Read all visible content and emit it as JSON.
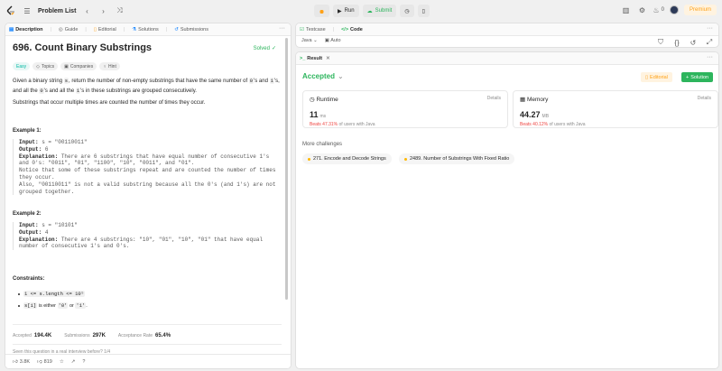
{
  "topbar": {
    "title": "Problem List",
    "run_label": "Run",
    "submit_label": "Submit",
    "notifications_count": "0",
    "premium_label": "Premium"
  },
  "left": {
    "tabs": [
      {
        "label": "Description"
      },
      {
        "label": "Guide"
      },
      {
        "label": "Editorial"
      },
      {
        "label": "Solutions"
      },
      {
        "label": "Submissions"
      }
    ],
    "problem_title": "696. Count Binary Substrings",
    "solved_label": "Solved",
    "tags": {
      "difficulty": "Easy",
      "topics": "Topics",
      "companies": "Companies",
      "hint": "Hint"
    },
    "desc1_a": "Given a binary string ",
    "desc1_code1": "s",
    "desc1_b": ", return the number of non-empty substrings that have the same number of ",
    "desc1_code2": "0",
    "desc1_c": "'s and ",
    "desc1_code3": "1",
    "desc1_d": "'s, and all the ",
    "desc1_code4": "0",
    "desc1_e": "'s and all the ",
    "desc1_code5": "1",
    "desc1_f": "'s in these substrings are grouped consecutively.",
    "desc2": "Substrings that occur multiple times are counted the number of times they occur.",
    "example1_title": "Example 1:",
    "example1": {
      "input_label": "Input:",
      "input": "s = \"00110011\"",
      "output_label": "Output:",
      "output": "6",
      "expl_label": "Explanation:",
      "expl": "There are 6 substrings that have equal number of consecutive 1's and 0's: \"0011\", \"01\", \"1100\", \"10\", \"0011\", and \"01\".\nNotice that some of these substrings repeat and are counted the number of times they occur.\nAlso, \"00110011\" is not a valid substring because all the 0's (and 1's) are not grouped together."
    },
    "example2_title": "Example 2:",
    "example2": {
      "input_label": "Input:",
      "input": "s = \"10101\"",
      "output_label": "Output:",
      "output": "4",
      "expl_label": "Explanation:",
      "expl": "There are 4 substrings: \"10\", \"01\", \"10\", \"01\" that have equal number of consecutive 1's and 0's."
    },
    "constraints_title": "Constraints:",
    "constraint1": "1 <= s.length <= 10⁵",
    "constraint2_code1": "s[i]",
    "constraint2_text": " is either ",
    "constraint2_code2": "'0'",
    "constraint2_or": " or ",
    "constraint2_code3": "'1'",
    "constraint2_end": ".",
    "stats": {
      "accepted_label": "Accepted",
      "accepted": "194.4K",
      "submissions_label": "Submissions",
      "submissions": "297K",
      "rate_label": "Acceptance Rate",
      "rate": "65.4%"
    },
    "seen_text": "Seen this question in a real interview before?   1/4",
    "likes": "3.8K",
    "dislikes": "819"
  },
  "rtop": {
    "tabs": [
      {
        "label": "Testcase"
      },
      {
        "label": "Code"
      }
    ],
    "language": "Java",
    "auto_label": "Auto"
  },
  "result": {
    "tab_label": "Result",
    "status": "Accepted",
    "editorial_label": "Editorial",
    "solution_label": "Solution",
    "runtime": {
      "title": "Runtime",
      "detail": "Details",
      "value": "11",
      "unit": "ms",
      "beats_pct": "Beats 47.31%",
      "beats_rest": " of users with Java"
    },
    "memory": {
      "title": "Memory",
      "detail": "Details",
      "value": "44.27",
      "unit": "MB",
      "beats_pct": "Beats 40.12%",
      "beats_rest": " of users with Java"
    },
    "more_title": "More challenges",
    "challenges": [
      "271. Encode and Decode Strings",
      "2489. Number of Substrings With Fixed Ratio"
    ]
  },
  "colors": {
    "accent_green": "#2db55d",
    "brand_orange": "#ffa116",
    "beats_red": "#ef4743"
  }
}
